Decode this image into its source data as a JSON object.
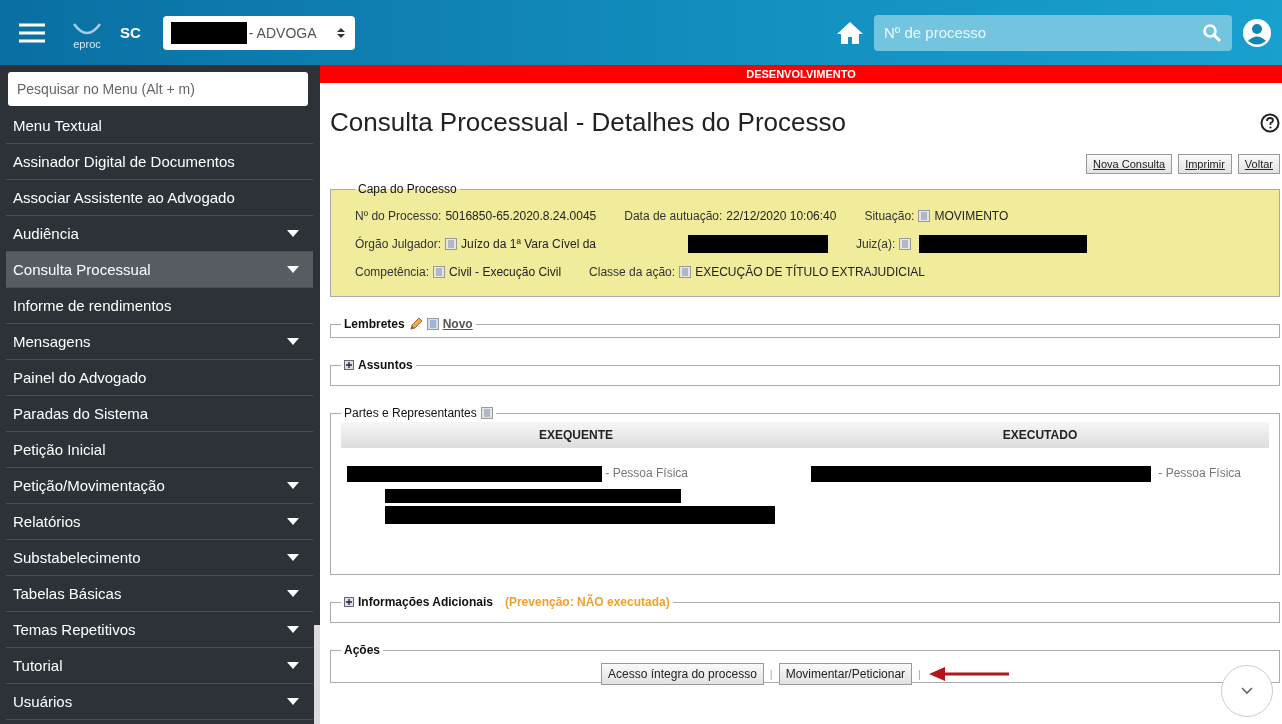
{
  "header": {
    "logo_text": "eproc",
    "region": "SC",
    "profile_suffix": "- ADVOGA",
    "search": {
      "placeholder": "Nº de processo"
    }
  },
  "sidebar": {
    "search": {
      "placeholder": "Pesquisar no Menu (Alt + m)"
    },
    "items": [
      {
        "label": "Menu Textual",
        "has_submenu": false,
        "selected": false
      },
      {
        "label": "Assinador Digital de Documentos",
        "has_submenu": false,
        "selected": false
      },
      {
        "label": "Associar Assistente ao Advogado",
        "has_submenu": false,
        "selected": false
      },
      {
        "label": "Audiência",
        "has_submenu": true,
        "selected": false
      },
      {
        "label": "Consulta Processual",
        "has_submenu": true,
        "selected": true
      },
      {
        "label": "Informe de rendimentos",
        "has_submenu": false,
        "selected": false
      },
      {
        "label": "Mensagens",
        "has_submenu": true,
        "selected": false
      },
      {
        "label": "Painel do Advogado",
        "has_submenu": false,
        "selected": false
      },
      {
        "label": "Paradas do Sistema",
        "has_submenu": false,
        "selected": false
      },
      {
        "label": "Petição Inicial",
        "has_submenu": false,
        "selected": false
      },
      {
        "label": "Petição/Movimentação",
        "has_submenu": true,
        "selected": false
      },
      {
        "label": "Relatórios",
        "has_submenu": true,
        "selected": false
      },
      {
        "label": "Substabelecimento",
        "has_submenu": true,
        "selected": false
      },
      {
        "label": "Tabelas Básicas",
        "has_submenu": true,
        "selected": false
      },
      {
        "label": "Temas Repetitivos",
        "has_submenu": true,
        "selected": false
      },
      {
        "label": "Tutorial",
        "has_submenu": true,
        "selected": false
      },
      {
        "label": "Usuários",
        "has_submenu": true,
        "selected": false
      }
    ]
  },
  "environment_banner": "DESENVOLVIMENTO",
  "page": {
    "title": "Consulta Processual - Detalhes do Processo",
    "buttons": [
      "Nova Consulta",
      "Imprimir",
      "Voltar"
    ]
  },
  "capa": {
    "title": "Capa do Processo",
    "rows": [
      [
        {
          "label": "Nº do Processo:",
          "value": "5016850-65.2020.8.24.0045",
          "icon": false,
          "redacted": false
        },
        {
          "label": "Data de autuação:",
          "value": "22/12/2020 10:06:40",
          "icon": false,
          "redacted": false
        },
        {
          "label": "Situação:",
          "value": "MOVIMENTO",
          "icon": true,
          "redacted": false
        }
      ],
      [
        {
          "label": "Órgão Julgador:",
          "value": "Juízo da 1ª Vara Cível da",
          "icon": true,
          "redacted": true
        },
        {
          "label": "Juiz(a):",
          "icon": true,
          "redacted": true
        }
      ],
      [
        {
          "label": "Competência:",
          "value": "Civil - Execução Civil",
          "icon": true,
          "redacted": false
        },
        {
          "label": "Classe da ação:",
          "value": "EXECUÇÃO DE TÍTULO EXTRAJUDICIAL",
          "icon": true,
          "redacted": false
        }
      ]
    ]
  },
  "lembretes": {
    "title": "Lembretes",
    "link": "Novo"
  },
  "assuntos": {
    "title": "Assuntos",
    "expanded": false
  },
  "partes": {
    "title": "Partes e Representantes",
    "columns": [
      "EXEQUENTE",
      "EXECUTADO"
    ],
    "parties": [
      {
        "suffix": "- Pessoa Física"
      },
      {
        "suffix": "- Pessoa Física"
      }
    ]
  },
  "informacoes": {
    "title": "Informações Adicionais",
    "note": "(Prevenção:  NÃO executada)",
    "expanded": false
  },
  "acoes": {
    "title": "Ações",
    "buttons": [
      "Acesso íntegra do processo",
      "Movimentar/Peticionar"
    ],
    "separator": "|"
  }
}
